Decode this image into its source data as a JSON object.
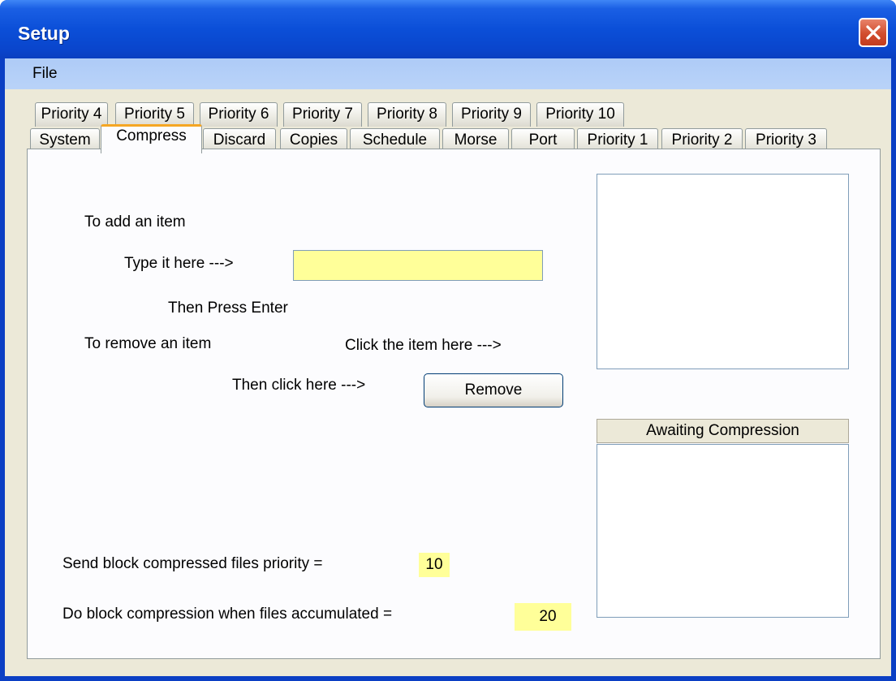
{
  "window": {
    "title": "Setup"
  },
  "menu": {
    "file": "File"
  },
  "tabs_row1": [
    "Priority 4",
    "Priority 5",
    "Priority 6",
    "Priority 7",
    "Priority 8",
    "Priority 9",
    "Priority 10"
  ],
  "tabs_row2": [
    "System",
    "Compress",
    "Discard",
    "Copies",
    "Schedule",
    "Morse",
    "Port",
    "Priority 1",
    "Priority 2",
    "Priority 3"
  ],
  "active_tab": "Compress",
  "compress": {
    "add_heading": "To add an item",
    "type_label": "Type it here --->",
    "add_input_value": "",
    "then_press": "Then Press Enter",
    "remove_heading": "To remove an item",
    "click_item_label": "Click the item here --->",
    "then_click_label": "Then click here --->",
    "remove_button": "Remove",
    "awaiting_header": "Awaiting Compression",
    "priority_label": "Send block compressed files priority =",
    "priority_value": "10",
    "accumulate_label": "Do block compression when files accumulated =",
    "accumulate_value": "20"
  },
  "colors": {
    "titlebar": "#0b4fd8",
    "close_button": "#d24d2e",
    "menubar": "#b9d3f8",
    "input_background": "#ffff99",
    "active_tab_accent": "#f5a623"
  },
  "icons": {
    "close": "close-icon"
  }
}
